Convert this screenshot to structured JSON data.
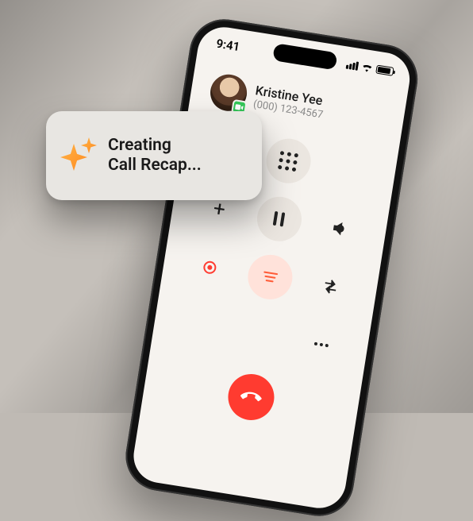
{
  "status_bar": {
    "time": "9:41"
  },
  "caller": {
    "name": "Kristine Yee",
    "number": "(000) 123-4567"
  },
  "toast": {
    "line1": "Creating",
    "line2": "Call Recap..."
  }
}
